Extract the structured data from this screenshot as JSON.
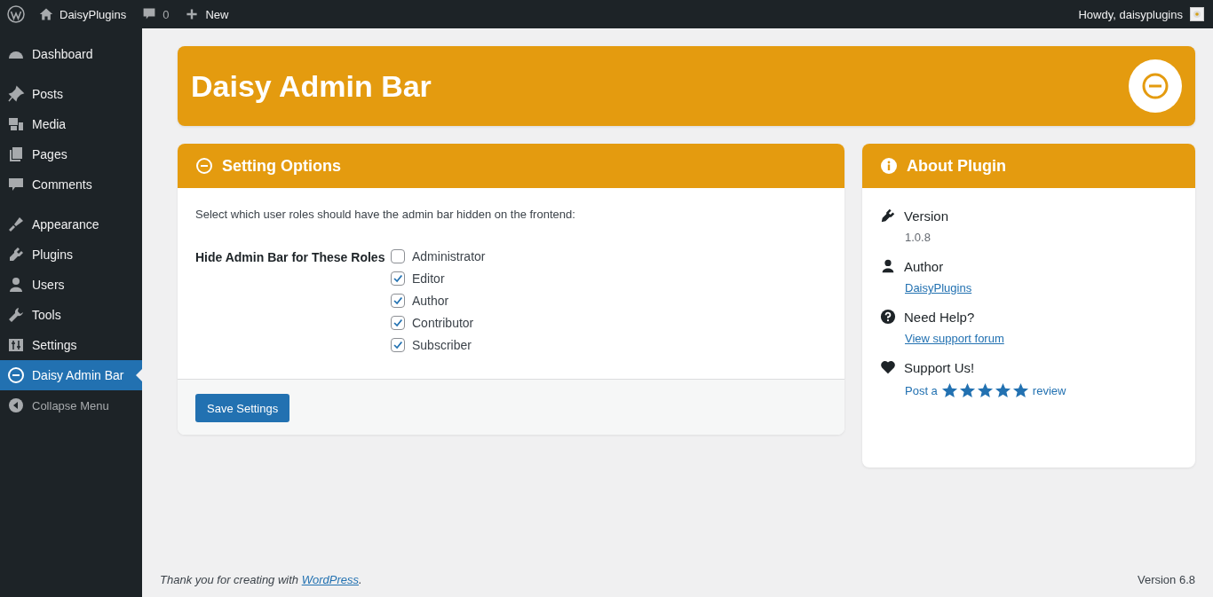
{
  "top_bar": {
    "site_name": "DaisyPlugins",
    "comments_count": "0",
    "new_label": "New",
    "greeting": "Howdy, daisyplugins"
  },
  "sidebar": {
    "groups": [
      [
        {
          "label": "Dashboard",
          "kind": "dashboard",
          "selected": false
        }
      ],
      [
        {
          "label": "Posts",
          "kind": "posts",
          "selected": false
        },
        {
          "label": "Media",
          "kind": "media",
          "selected": false
        },
        {
          "label": "Pages",
          "kind": "pages",
          "selected": false
        },
        {
          "label": "Comments",
          "kind": "comments",
          "selected": false
        }
      ],
      [
        {
          "label": "Appearance",
          "kind": "appearance",
          "selected": false
        },
        {
          "label": "Plugins",
          "kind": "plugins",
          "selected": false
        },
        {
          "label": "Users",
          "kind": "users",
          "selected": false
        },
        {
          "label": "Tools",
          "kind": "tools",
          "selected": false
        },
        {
          "label": "Settings",
          "kind": "settings",
          "selected": false
        },
        {
          "label": "Daisy Admin Bar",
          "kind": "daisy",
          "selected": true
        }
      ]
    ],
    "collapse_label": "Collapse Menu"
  },
  "header": {
    "title": "Daisy Admin Bar"
  },
  "settings_card": {
    "title": "Setting Options",
    "description": "Select which user roles should have the admin bar hidden on the frontend:",
    "field_label": "Hide Admin Bar for These Roles",
    "roles": [
      {
        "label": "Administrator",
        "checked": false
      },
      {
        "label": "Editor",
        "checked": true
      },
      {
        "label": "Author",
        "checked": true
      },
      {
        "label": "Contributor",
        "checked": true
      },
      {
        "label": "Subscriber",
        "checked": true
      }
    ],
    "save_button": "Save Settings"
  },
  "about_card": {
    "title": "About Plugin",
    "items": [
      {
        "kind": "version",
        "heading": "Version",
        "value": "1.0.8"
      },
      {
        "kind": "author",
        "heading": "Author",
        "link": "DaisyPlugins"
      },
      {
        "kind": "help",
        "heading": "Need Help?",
        "link": "View support forum"
      },
      {
        "kind": "support",
        "heading": "Support Us!",
        "before": "Post a",
        "stars": 5,
        "after": "review"
      }
    ]
  },
  "footer": {
    "thanks": "Thank you for creating with ",
    "link": "WordPress",
    "end": ".",
    "version": "Version 6.8"
  }
}
